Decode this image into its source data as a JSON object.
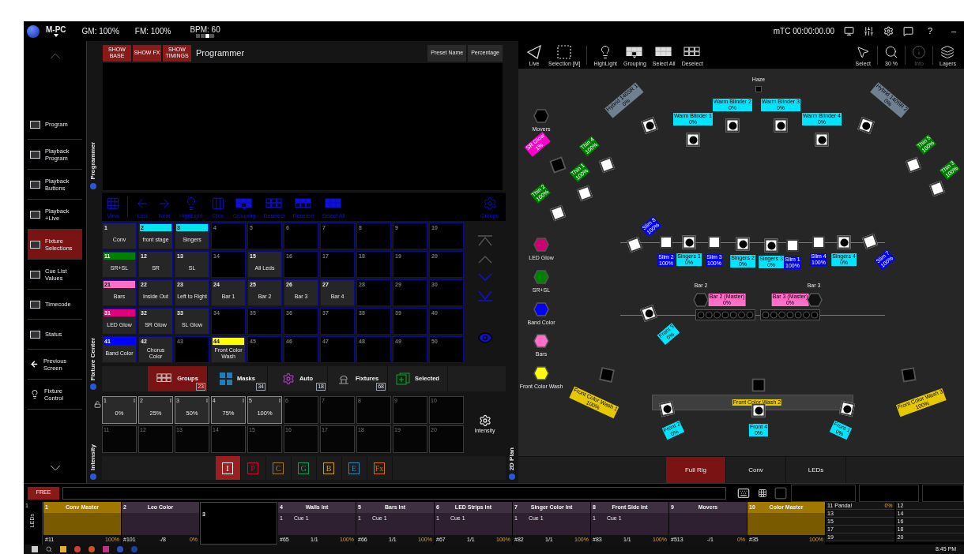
{
  "top_bar": {
    "app_name": "M-PC",
    "master_levels": [
      "GM: 100%",
      "FM: 100%"
    ],
    "bpm": "BPM: 60",
    "pages": [
      {
        "selected": false
      },
      {
        "selected": false
      },
      {
        "selected": true
      },
      {
        "selected": false
      }
    ],
    "timecode": "mTC 00:00:00.00",
    "help": "?",
    "minimize": "–"
  },
  "sidebar": {
    "items": [
      {
        "label": "Program",
        "kind": "screen",
        "selected": false
      },
      {
        "label": "Playback Program",
        "kind": "screen",
        "selected": false
      },
      {
        "label": "Playback Buttons",
        "kind": "screen",
        "selected": false
      },
      {
        "label": "Playback +Live",
        "kind": "screen",
        "selected": false
      },
      {
        "label": "Fixture Selections",
        "kind": "screen",
        "selected": true
      },
      {
        "label": "Cue List Values",
        "kind": "screen",
        "selected": false
      },
      {
        "label": "Timecode",
        "kind": "screen",
        "selected": false
      },
      {
        "label": "Status",
        "kind": "screen",
        "selected": false
      },
      {
        "label": "Previous Screen",
        "kind": "back",
        "selected": false
      },
      {
        "label": "Fixture Control",
        "kind": "bulb",
        "selected": false
      }
    ]
  },
  "programmer": {
    "side_label": "Programmer",
    "toggles": [
      "SHOW BASE",
      "SHOW FX",
      "SHOW TIMINGS"
    ],
    "title": "Programmer",
    "columns": [
      "Preset Name",
      "Percentage"
    ]
  },
  "fixture_center": {
    "side_label": "Fixture Center",
    "toolbar": [
      {
        "label": "View",
        "kind": "grid"
      },
      {
        "label": "Last",
        "kind": "left"
      },
      {
        "label": "Next",
        "kind": "right"
      },
      {
        "label": "HighLight",
        "kind": "bulb"
      },
      {
        "label": "Slice",
        "kind": "columns"
      },
      {
        "label": "Grouping",
        "kind": "grouping"
      },
      {
        "label": "Deselect",
        "kind": "deselect"
      },
      {
        "label": "Reselect",
        "kind": "reselect"
      },
      {
        "label": "Select All",
        "kind": "select-all"
      },
      {
        "label": "Groups",
        "kind": "gear"
      }
    ],
    "groups": [
      {
        "number": "1",
        "label": "Conv"
      },
      {
        "number": "2",
        "label": "front stage",
        "color": "#00e5ee"
      },
      {
        "number": "3",
        "label": "Singers",
        "color": "#00e5ee"
      },
      {
        "number": "4"
      },
      {
        "number": "5"
      },
      {
        "number": "6"
      },
      {
        "number": "7"
      },
      {
        "number": "8"
      },
      {
        "number": "9"
      },
      {
        "number": "10"
      },
      {
        "number": "11",
        "label": "SR+SL",
        "color": "#008000"
      },
      {
        "number": "12",
        "label": "SR"
      },
      {
        "number": "13",
        "label": "SL"
      },
      {
        "number": "14"
      },
      {
        "number": "15",
        "label": "All Leds"
      },
      {
        "number": "16"
      },
      {
        "number": "17"
      },
      {
        "number": "18"
      },
      {
        "number": "19"
      },
      {
        "number": "20"
      },
      {
        "number": "21",
        "label": "Bars",
        "color": "#ff6ec7"
      },
      {
        "number": "22",
        "label": "Inside Out"
      },
      {
        "number": "23",
        "label": "Left to Right"
      },
      {
        "number": "24",
        "label": "Bar 1"
      },
      {
        "number": "25",
        "label": "Bar 2"
      },
      {
        "number": "26",
        "label": "Bar 3"
      },
      {
        "number": "27",
        "label": "Bar 4"
      },
      {
        "number": "28"
      },
      {
        "number": "29"
      },
      {
        "number": "30"
      },
      {
        "number": "31",
        "label": "LED Glow",
        "color": "#e0007a"
      },
      {
        "number": "32",
        "label": "SR Glow"
      },
      {
        "number": "33",
        "label": "SL Glow"
      },
      {
        "number": "34"
      },
      {
        "number": "35"
      },
      {
        "number": "36"
      },
      {
        "number": "37"
      },
      {
        "number": "38"
      },
      {
        "number": "39"
      },
      {
        "number": "40"
      },
      {
        "number": "41",
        "label": "Band Color",
        "color": "#0000ff"
      },
      {
        "number": "42",
        "label": "Chorus Color"
      },
      {
        "number": "43"
      },
      {
        "number": "44",
        "label": "Front Color Wash",
        "color": "#ffff00"
      },
      {
        "number": "45"
      },
      {
        "number": "46"
      },
      {
        "number": "47"
      },
      {
        "number": "48"
      },
      {
        "number": "49"
      },
      {
        "number": "50"
      }
    ],
    "tabs": [
      {
        "label": "Groups",
        "kind": "groups",
        "count": "23",
        "selected": true
      },
      {
        "label": "Masks",
        "kind": "masks",
        "count": "34",
        "selected": false
      },
      {
        "label": "Auto",
        "kind": "auto",
        "count": "18",
        "selected": false
      },
      {
        "label": "Fixtures",
        "kind": "fixtures",
        "count": "68",
        "selected": false
      },
      {
        "label": "Selected",
        "kind": "selected",
        "selected": false
      }
    ]
  },
  "intensity": {
    "side_label": "Intensity",
    "presets": [
      {
        "number": "1",
        "label": "0%",
        "attribute": "I"
      },
      {
        "number": "2",
        "label": "25%",
        "attribute": "I"
      },
      {
        "number": "3",
        "label": "50%",
        "attribute": "I"
      },
      {
        "number": "4",
        "label": "75%",
        "attribute": "I"
      },
      {
        "number": "5",
        "label": "100%",
        "attribute": "I"
      },
      {
        "number": "6"
      },
      {
        "number": "7"
      },
      {
        "number": "8"
      },
      {
        "number": "9"
      },
      {
        "number": "10"
      },
      {
        "number": "11"
      },
      {
        "number": "12"
      },
      {
        "number": "13"
      },
      {
        "number": "14"
      },
      {
        "number": "15"
      },
      {
        "number": "16"
      },
      {
        "number": "17"
      },
      {
        "number": "18"
      },
      {
        "number": "19"
      },
      {
        "number": "20"
      }
    ],
    "settings": "Intensity",
    "attributes": [
      {
        "label": "I",
        "color": "#ffffff",
        "selected": true
      },
      {
        "label": "P",
        "color": "#c8102e",
        "selected": false
      },
      {
        "label": "C",
        "color": "#a07838",
        "selected": false
      },
      {
        "label": "G",
        "color": "#1e9a5a",
        "selected": false
      },
      {
        "label": "B",
        "color": "#c8a020",
        "selected": false
      },
      {
        "label": "E",
        "color": "#3a8ab0",
        "selected": false
      },
      {
        "label": "Fx",
        "color": "#d07010",
        "selected": false
      }
    ]
  },
  "plan": {
    "side_label": "2D Plan",
    "toolbar": [
      {
        "label": "Live",
        "kind": "live",
        "disabled": false
      },
      {
        "label": "Selection [M]",
        "kind": "selection",
        "disabled": false
      },
      {
        "label": "HighLight",
        "kind": "bulb",
        "disabled": false
      },
      {
        "label": "Grouping",
        "kind": "grouping",
        "disabled": false
      },
      {
        "label": "Select All",
        "kind": "select-all",
        "disabled": false
      },
      {
        "label": "Deselect",
        "kind": "deselect",
        "disabled": false
      },
      {
        "label": "Select",
        "kind": "cursor",
        "disabled": false
      },
      {
        "label": "30 %",
        "kind": "zoom",
        "disabled": false
      },
      {
        "label": "Info",
        "kind": "info",
        "disabled": true
      },
      {
        "label": "Layers",
        "kind": "layers",
        "disabled": false
      }
    ],
    "legend": [
      {
        "label": "Movers",
        "color": "#000000"
      },
      {
        "label": "LED Glow",
        "color": "#cc0070"
      },
      {
        "label": "SR+SL",
        "color": "#008000"
      },
      {
        "label": "Band Color",
        "color": "#0000ff"
      },
      {
        "label": "Bars",
        "color": "#ff6ec7"
      },
      {
        "label": "Front Color Wash",
        "color": "#ffff00"
      }
    ],
    "fixtures": [
      {
        "label": "Haze",
        "kind": "haze"
      },
      {
        "label": "Hybrid 140SR 1",
        "value": "0%",
        "kind": "spot",
        "color": "#708090"
      },
      {
        "label": "Warm Blinder 2",
        "value": "0%",
        "kind": "spot",
        "color": "#00e5ff"
      },
      {
        "label": "Warm Blinder 3",
        "value": "0%",
        "kind": "spot",
        "color": "#00e5ff"
      },
      {
        "label": "Warm Blinder 1",
        "value": "0%",
        "kind": "spot",
        "color": "#00e5ff"
      },
      {
        "label": "Warm Blinder 4",
        "value": "0%",
        "kind": "spot",
        "color": "#00e5ff"
      },
      {
        "label": "Hybrid 140SR 2",
        "value": "0%",
        "kind": "spot",
        "color": "#708090"
      },
      {
        "label": "SR Glow",
        "value": "1%",
        "kind": "led",
        "color": "#ff00cc"
      },
      {
        "label": "Thin 4",
        "value": "100%",
        "kind": "wash",
        "color": "#008000"
      },
      {
        "label": "Thin 1",
        "value": "100%",
        "kind": "wash",
        "color": "#008000"
      },
      {
        "label": "Thin 2",
        "value": "100%",
        "kind": "wash",
        "color": "#008000"
      },
      {
        "label": "Thin 5",
        "value": "100%",
        "kind": "wash",
        "color": "#008000"
      },
      {
        "label": "Thin 3",
        "value": "100%",
        "kind": "wash",
        "color": "#008000"
      },
      {
        "label": "Slim 8",
        "value": "100%",
        "kind": "wash",
        "color": "#0000ff"
      },
      {
        "label": "Slim 2",
        "value": "100%",
        "kind": "wash",
        "color": "#0000ff"
      },
      {
        "label": "Singers 1",
        "value": "0%",
        "kind": "spot",
        "color": "#00e5ff"
      },
      {
        "label": "Slim 3",
        "value": "100%",
        "kind": "wash",
        "color": "#0000ff"
      },
      {
        "label": "Singers 2",
        "value": "0%",
        "kind": "spot",
        "color": "#00e5ff"
      },
      {
        "label": "Singers 3",
        "value": "0%",
        "kind": "spot",
        "color": "#00e5ff"
      },
      {
        "label": "Slim 1",
        "value": "100%",
        "kind": "wash",
        "color": "#0000ff"
      },
      {
        "label": "Slim 4",
        "value": "100%",
        "kind": "wash",
        "color": "#0000ff"
      },
      {
        "label": "Singers 4",
        "value": "0%",
        "kind": "spot",
        "color": "#00e5ff"
      },
      {
        "label": "Slim 7",
        "value": "100%",
        "kind": "wash",
        "color": "#0000ff"
      },
      {
        "label": "Bar 2 (Master)",
        "value": "0%",
        "kind": "strip",
        "color": "#ff6ec7"
      },
      {
        "label": "Bar 3 (Master)",
        "value": "0%",
        "kind": "strip",
        "color": "#ff6ec7"
      },
      {
        "label": "Bar 2",
        "kind": "hex"
      },
      {
        "label": "Bar 3",
        "kind": "hex"
      },
      {
        "label": "Front 3",
        "value": "0%",
        "kind": "spot",
        "color": "#00e5ff"
      },
      {
        "label": "Front Color Wash 1",
        "value": "100%",
        "kind": "led",
        "color": "#e6c800"
      },
      {
        "label": "Front Color Wash 2",
        "kind": "led",
        "color": "#e6c800"
      },
      {
        "label": "Front Color Wash 3",
        "value": "100%",
        "kind": "led",
        "color": "#e6c800"
      },
      {
        "label": "Front 2",
        "value": "0%",
        "kind": "spot",
        "color": "#00e5ff"
      },
      {
        "label": "Front 4",
        "value": "0%",
        "kind": "spot",
        "color": "#00e5ff"
      },
      {
        "label": "Front 1",
        "value": "0%",
        "kind": "spot",
        "color": "#00e5ff"
      }
    ],
    "tabs": [
      {
        "label": "Full Rig",
        "selected": true
      },
      {
        "label": "Conv",
        "selected": false
      },
      {
        "label": "LEDs",
        "selected": false
      }
    ]
  },
  "command_line": {
    "mode": "FREE"
  },
  "playbacks": {
    "page": "1",
    "page_name": "LEDs",
    "faders": [
      {
        "number": "1",
        "name": "Conv Master",
        "kind": "master",
        "id": "#11",
        "value": "100%"
      },
      {
        "number": "2",
        "name": "Leo Color",
        "kind": "cuelist",
        "id": "#101",
        "progress": "-/8",
        "value": "0%"
      },
      {
        "number": "3",
        "kind": "empty"
      },
      {
        "number": "4",
        "name": "Walls Int",
        "kind": "cuelist",
        "cue_number": "1",
        "cue": "Cue 1",
        "id": "#65",
        "progress": "1/1",
        "value": "100%"
      },
      {
        "number": "5",
        "name": "Bars Int",
        "kind": "cuelist",
        "cue_number": "1",
        "cue": "Cue 1",
        "id": "#66",
        "progress": "1/1",
        "value": "100%"
      },
      {
        "number": "6",
        "name": "LED Strips Int",
        "kind": "cuelist",
        "cue_number": "1",
        "cue": "Cue 1",
        "id": "#67",
        "progress": "1/1",
        "value": "100%"
      },
      {
        "number": "7",
        "name": "Singer Color Int",
        "kind": "cuelist",
        "cue_number": "1",
        "cue": "Cue 1",
        "id": "#82",
        "progress": "1/1",
        "value": "100%"
      },
      {
        "number": "8",
        "name": "Front Side Int",
        "kind": "cuelist",
        "cue_number": "1",
        "cue": "Cue 1",
        "id": "#83",
        "progress": "1/1",
        "value": "100%"
      },
      {
        "number": "9",
        "name": "Movers",
        "kind": "cuelist",
        "id": "#513",
        "progress": "-/1",
        "value": "0%"
      },
      {
        "number": "10",
        "name": "Color Master",
        "kind": "master",
        "id": "#35",
        "value": "100%"
      }
    ],
    "list": [
      {
        "number": "11",
        "label": "Panda!",
        "value": "0%"
      },
      {
        "number": "12"
      },
      {
        "number": "13"
      },
      {
        "number": "14"
      },
      {
        "number": "15"
      },
      {
        "number": "16"
      },
      {
        "number": "17"
      },
      {
        "number": "18"
      },
      {
        "number": "19"
      },
      {
        "number": "20"
      }
    ]
  },
  "taskbar": {
    "time": "8:45 PM"
  }
}
